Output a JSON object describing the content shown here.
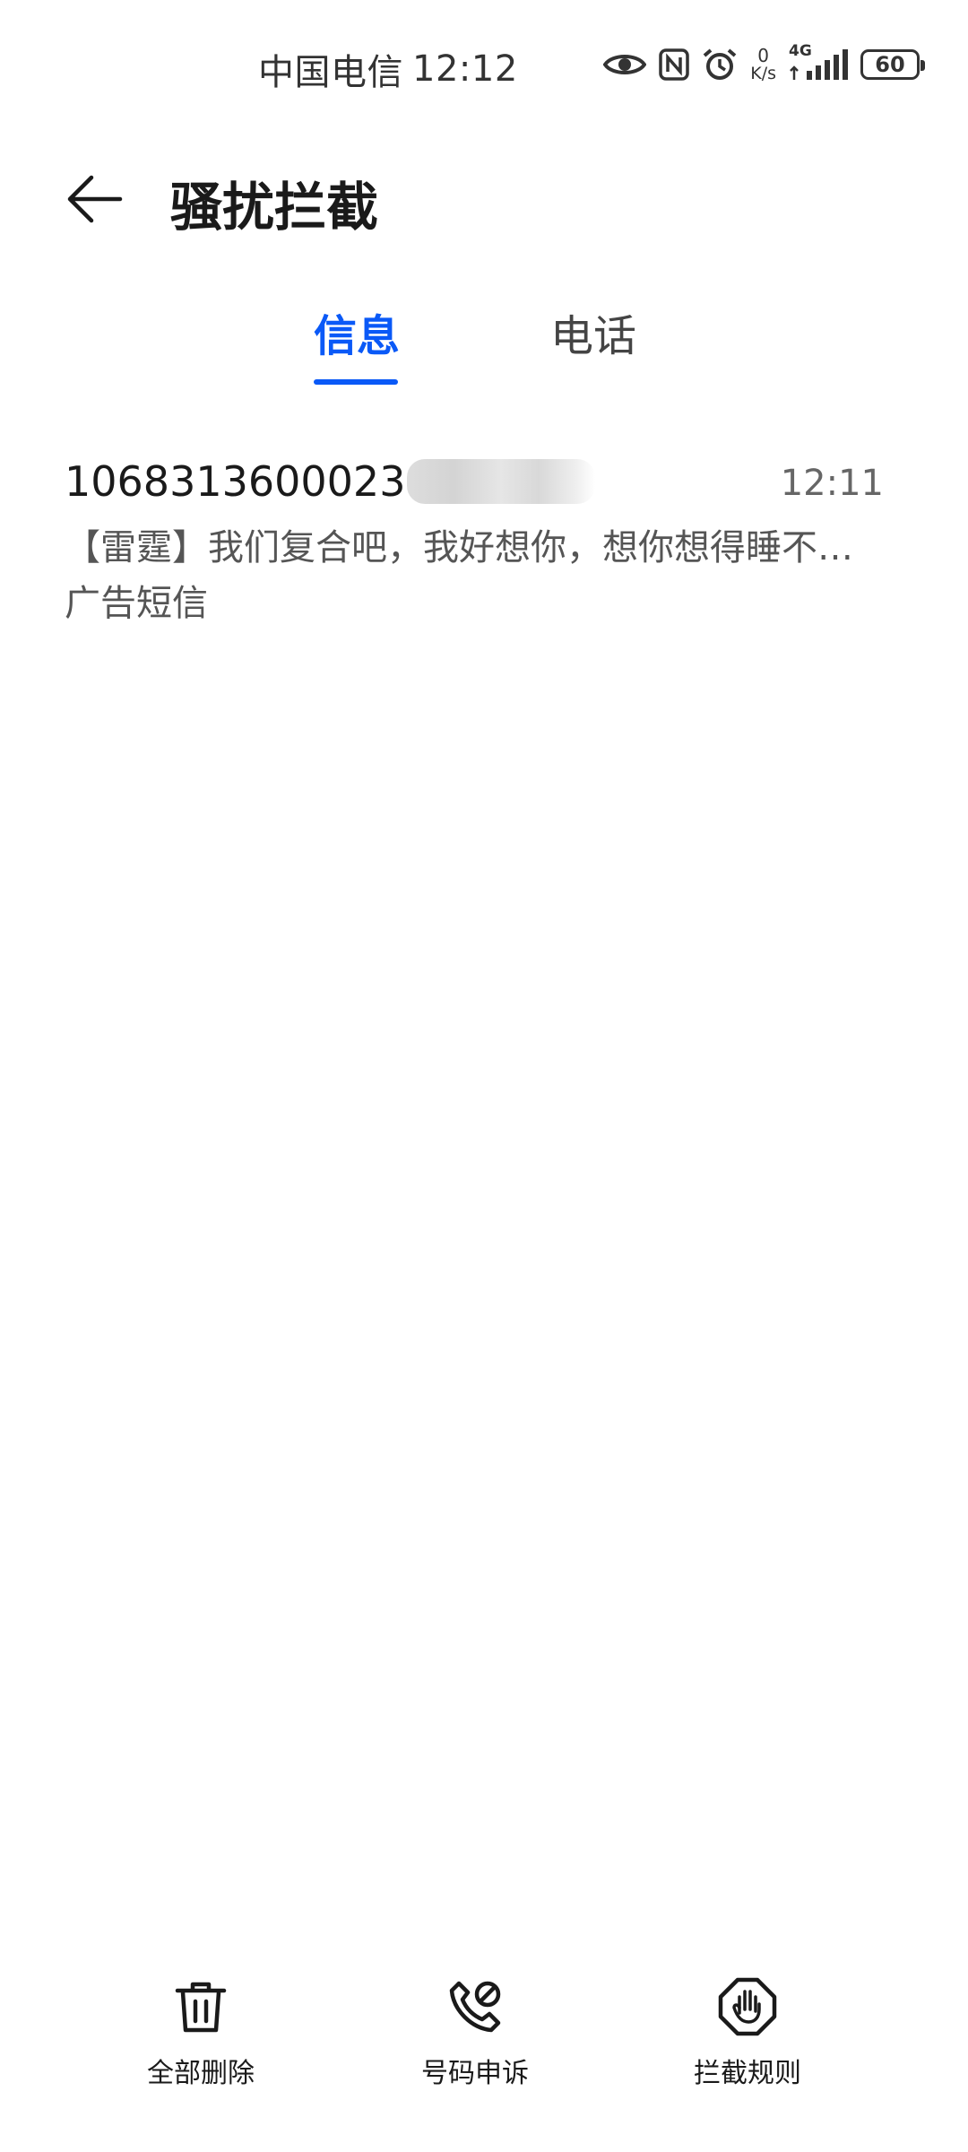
{
  "status_bar": {
    "carrier": "中国电信",
    "time": "12:12",
    "speed_value": "0",
    "speed_unit": "K/s",
    "network": "4G",
    "battery": "60"
  },
  "header": {
    "title": "骚扰拦截"
  },
  "tabs": [
    {
      "label": "信息",
      "active": true
    },
    {
      "label": "电话",
      "active": false
    }
  ],
  "messages": [
    {
      "sender": "1068313600023",
      "time": "12:11",
      "preview": "【雷霆】我们复合吧，我好想你，想你想得睡不…",
      "tag": "广告短信"
    }
  ],
  "toolbar": {
    "delete_all": "全部删除",
    "number_appeal": "号码申诉",
    "block_rules": "拦截规则"
  },
  "colors": {
    "accent": "#0a59f7",
    "text_primary": "#1a1a1a",
    "text_secondary": "#555555"
  }
}
